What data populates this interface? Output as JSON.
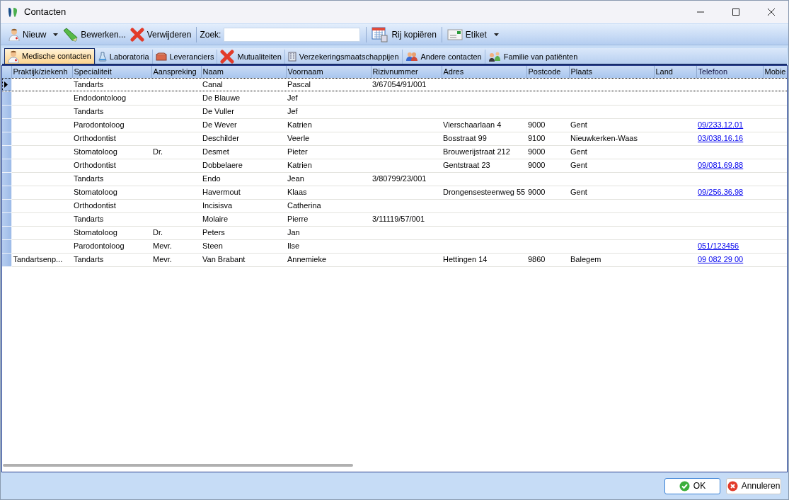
{
  "window": {
    "title": "Contacten"
  },
  "toolbar": {
    "items": [
      {
        "kind": "button",
        "label": "Nieuw",
        "dropdown": true
      },
      {
        "kind": "button",
        "label": "Bewerken...",
        "dropdown": false
      },
      {
        "kind": "button",
        "label": "Verwijderen",
        "dropdown": false
      },
      {
        "kind": "search",
        "label": "Zoek:"
      },
      {
        "kind": "button",
        "label": "Rij kopiëren",
        "dropdown": false
      },
      {
        "kind": "button",
        "label": "Etiket",
        "dropdown": true
      }
    ]
  },
  "tabs": [
    {
      "label": "Medische contacten",
      "selected": true
    },
    {
      "label": "Laboratoria",
      "selected": false
    },
    {
      "label": "Leveranciers",
      "selected": false
    },
    {
      "label": "Mutualiteiten",
      "selected": false
    },
    {
      "label": "Verzekeringsmaatschappijen",
      "selected": false
    },
    {
      "label": "Andere contacten",
      "selected": false
    },
    {
      "label": "Familie van patiënten",
      "selected": false
    }
  ],
  "table": {
    "columns": [
      {
        "label": "Praktijk/ziekenh",
        "kind": "text"
      },
      {
        "label": "Specialiteit",
        "kind": "text"
      },
      {
        "label": "Aanspreking",
        "kind": "text"
      },
      {
        "label": "Naam",
        "kind": "text"
      },
      {
        "label": "Voornaam",
        "kind": "text"
      },
      {
        "label": "Rizivnummer",
        "kind": "text"
      },
      {
        "label": "Adres",
        "kind": "text"
      },
      {
        "label": "Postcode",
        "kind": "text"
      },
      {
        "label": "Plaats",
        "kind": "text"
      },
      {
        "label": "Land",
        "kind": "text"
      },
      {
        "label": "Telefoon",
        "kind": "link"
      },
      {
        "label": "Mobie",
        "kind": "text"
      }
    ],
    "rows": [
      {
        "selected": true,
        "cells": [
          null,
          "Tandarts",
          null,
          "Canal",
          "Pascal",
          "3/67054/91/001",
          null,
          null,
          null,
          null,
          null,
          null
        ]
      },
      {
        "selected": false,
        "cells": [
          null,
          "Endodontoloog",
          null,
          "De Blauwe",
          "Jef",
          null,
          null,
          null,
          null,
          null,
          null,
          null
        ]
      },
      {
        "selected": false,
        "cells": [
          null,
          "Tandarts",
          null,
          "De Vuller",
          "Jef",
          null,
          null,
          null,
          null,
          null,
          null,
          null
        ]
      },
      {
        "selected": false,
        "cells": [
          null,
          "Parodontoloog",
          null,
          "De Wever",
          "Katrien",
          null,
          "Vierschaarlaan 4",
          "9000",
          "Gent",
          null,
          "09/233.12.01",
          null
        ]
      },
      {
        "selected": false,
        "cells": [
          null,
          "Orthodontist",
          null,
          "Deschilder",
          "Veerle",
          null,
          "Bosstraat 99",
          "9100",
          "Nieuwkerken-Waas",
          null,
          "03/038.16.16",
          null
        ]
      },
      {
        "selected": false,
        "cells": [
          null,
          "Stomatoloog",
          "Dr.",
          "Desmet",
          "Pieter",
          null,
          "Brouwerijstraat 212",
          "9000",
          "Gent",
          null,
          null,
          null
        ]
      },
      {
        "selected": false,
        "cells": [
          null,
          "Orthodontist",
          null,
          "Dobbelaere",
          "Katrien",
          null,
          "Gentstraat 23",
          "9000",
          "Gent",
          null,
          "09/081.69.88",
          null
        ]
      },
      {
        "selected": false,
        "cells": [
          null,
          "Tandarts",
          null,
          "Endo",
          "Jean",
          "3/80799/23/001",
          null,
          null,
          null,
          null,
          null,
          null
        ]
      },
      {
        "selected": false,
        "cells": [
          null,
          "Stomatoloog",
          null,
          "Havermout",
          "Klaas",
          null,
          "Drongensesteenweg 55",
          "9000",
          "Gent",
          null,
          "09/256.36.98",
          null
        ]
      },
      {
        "selected": false,
        "cells": [
          null,
          "Orthodontist",
          null,
          "Incisisva",
          "Catherina",
          null,
          null,
          null,
          null,
          null,
          null,
          null
        ]
      },
      {
        "selected": false,
        "cells": [
          null,
          "Tandarts",
          null,
          "Molaire",
          "Pierre",
          "3/11119/57/001",
          null,
          null,
          null,
          null,
          null,
          null
        ]
      },
      {
        "selected": false,
        "cells": [
          null,
          "Stomatoloog",
          "Dr.",
          "Peters",
          "Jan",
          null,
          null,
          null,
          null,
          null,
          null,
          null
        ]
      },
      {
        "selected": false,
        "cells": [
          null,
          "Parodontoloog",
          "Mevr.",
          "Steen",
          "Ilse",
          null,
          null,
          null,
          null,
          null,
          "051/123456",
          null
        ]
      },
      {
        "selected": false,
        "cells": [
          "Tandartsenp...",
          "Tandarts",
          "Mevr.",
          "Van Brabant",
          "Annemieke",
          null,
          "Hettingen 14",
          "9860",
          "Balegem",
          null,
          "09 082 29 00",
          null
        ]
      }
    ]
  },
  "buttons": [
    {
      "label": "OK"
    },
    {
      "label": "Annuleren"
    }
  ]
}
